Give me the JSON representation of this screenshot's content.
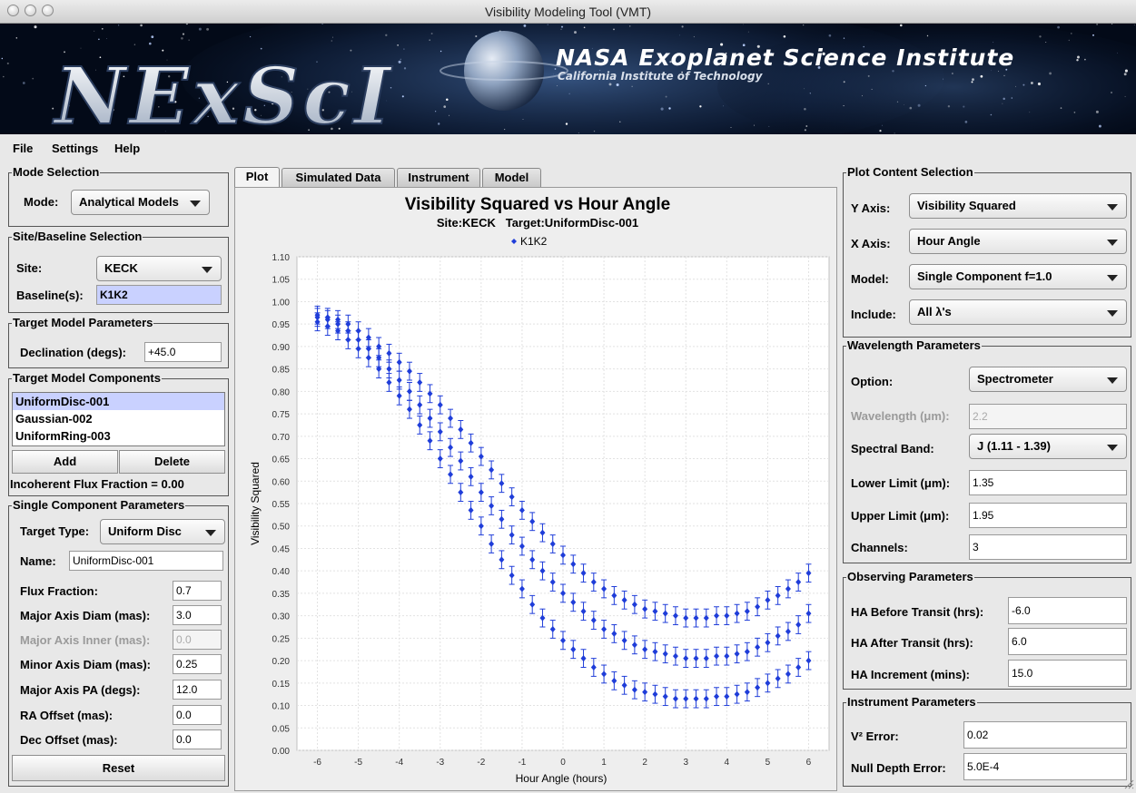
{
  "window": {
    "title": "Visibility Modeling Tool (VMT)"
  },
  "banner": {
    "logo": "NExScI",
    "headline": "NASA Exoplanet Science Institute",
    "subline": "California Institute of Technology"
  },
  "menu": [
    "File",
    "Settings",
    "Help"
  ],
  "mode_selection": {
    "legend": "Mode Selection",
    "mode_label": "Mode:",
    "mode_value": "Analytical Models"
  },
  "site_selection": {
    "legend": "Site/Baseline Selection",
    "site_label": "Site:",
    "site_value": "KECK",
    "baseline_label": "Baseline(s):",
    "baseline_value": "K1K2"
  },
  "target_params": {
    "legend": "Target Model Parameters",
    "decl_label": "Declination (degs):",
    "decl_value": "+45.0"
  },
  "target_components": {
    "legend": "Target Model Components",
    "items": [
      "UniformDisc-001",
      "Gaussian-002",
      "UniformRing-003"
    ],
    "selected": 0,
    "add_label": "Add",
    "delete_label": "Delete",
    "incoherent": "Incoherent Flux Fraction = 0.00"
  },
  "single_component": {
    "legend": "Single Component Parameters",
    "type_label": "Target Type:",
    "type_value": "Uniform Disc",
    "name_label": "Name:",
    "name_value": "UniformDisc-001",
    "fields": [
      {
        "label": "Flux Fraction:",
        "value": "0.7",
        "disabled": false
      },
      {
        "label": "Major Axis Diam (mas):",
        "value": "3.0",
        "disabled": false
      },
      {
        "label": "Major Axis Inner (mas):",
        "value": "0.0",
        "disabled": true
      },
      {
        "label": "Minor Axis Diam (mas):",
        "value": "0.25",
        "disabled": false
      },
      {
        "label": "Major Axis PA (degs):",
        "value": "12.0",
        "disabled": false
      },
      {
        "label": "RA Offset (mas):",
        "value": "0.0",
        "disabled": false
      },
      {
        "label": "Dec Offset (mas):",
        "value": "0.0",
        "disabled": false
      }
    ],
    "reset_label": "Reset"
  },
  "tabs": [
    "Plot",
    "Simulated Data",
    "Instrument",
    "Model"
  ],
  "active_tab": 0,
  "plot_content": {
    "legend": "Plot Content Selection",
    "rows": [
      {
        "label": "Y Axis:",
        "value": "Visibility Squared"
      },
      {
        "label": "X Axis:",
        "value": "Hour Angle"
      },
      {
        "label": "Model:",
        "value": "Single Component f=1.0"
      },
      {
        "label": "Include:",
        "value": "All λ's"
      }
    ]
  },
  "wavelength": {
    "legend": "Wavelength Parameters",
    "option_label": "Option:",
    "option_value": "Spectrometer",
    "wl_label": "Wavelength (μm):",
    "wl_value": "2.2",
    "band_label": "Spectral Band:",
    "band_value": "J (1.11 - 1.39)",
    "lower_label": "Lower Limit (μm):",
    "lower_value": "1.35",
    "upper_label": "Upper Limit (μm):",
    "upper_value": "1.95",
    "channels_label": "Channels:",
    "channels_value": "3"
  },
  "observing": {
    "legend": "Observing Parameters",
    "before_label": "HA Before Transit (hrs):",
    "before_value": "-6.0",
    "after_label": "HA After Transit (hrs):",
    "after_value": "6.0",
    "incr_label": "HA Increment (mins):",
    "incr_value": "15.0"
  },
  "instrument": {
    "legend": "Instrument Parameters",
    "v2err_label": "V² Error:",
    "v2err_value": "0.02",
    "null_label": "Null Depth Error:",
    "null_value": "5.0E-4"
  },
  "chart_data": {
    "type": "scatter",
    "title": "Visibility Squared vs Hour Angle",
    "subtitle": "Site:KECK   Target:UniformDisc-001",
    "legend": [
      "K1K2"
    ],
    "xlabel": "Hour Angle (hours)",
    "ylabel": "Visibility Squared",
    "xlim": [
      -6.5,
      6.5
    ],
    "ylim": [
      0,
      1.1
    ],
    "xticks": [
      "-6",
      "-5",
      "-4",
      "-3",
      "-2",
      "-1",
      "0",
      "1",
      "2",
      "3",
      "4",
      "5",
      "6"
    ],
    "yticks": [
      "0.00",
      "0.05",
      "0.10",
      "0.15",
      "0.20",
      "0.25",
      "0.30",
      "0.35",
      "0.40",
      "0.45",
      "0.50",
      "0.55",
      "0.60",
      "0.65",
      "0.70",
      "0.75",
      "0.80",
      "0.85",
      "0.90",
      "0.95",
      "1.00",
      "1.05",
      "1.10"
    ],
    "error": 0.02,
    "x": [
      -6,
      -5.75,
      -5.5,
      -5.25,
      -5,
      -4.75,
      -4.5,
      -4.25,
      -4,
      -3.75,
      -3.5,
      -3.25,
      -3,
      -2.75,
      -2.5,
      -2.25,
      -2,
      -1.75,
      -1.5,
      -1.25,
      -1,
      -0.75,
      -0.5,
      -0.25,
      0,
      0.25,
      0.5,
      0.75,
      1,
      1.25,
      1.5,
      1.75,
      2,
      2.25,
      2.5,
      2.75,
      3,
      3.25,
      3.5,
      3.75,
      4,
      4.25,
      4.5,
      4.75,
      5,
      5.25,
      5.5,
      5.75,
      6
    ],
    "series": [
      {
        "name": "K1K2",
        "values": [
          0.97,
          0.965,
          0.96,
          0.95,
          0.935,
          0.92,
          0.9,
          0.885,
          0.865,
          0.845,
          0.82,
          0.795,
          0.77,
          0.74,
          0.715,
          0.685,
          0.655,
          0.625,
          0.595,
          0.565,
          0.535,
          0.51,
          0.485,
          0.46,
          0.435,
          0.415,
          0.395,
          0.375,
          0.36,
          0.345,
          0.335,
          0.325,
          0.315,
          0.31,
          0.305,
          0.3,
          0.295,
          0.295,
          0.295,
          0.3,
          0.3,
          0.305,
          0.31,
          0.32,
          0.335,
          0.345,
          0.36,
          0.375,
          0.395
        ]
      },
      {
        "name": "K1K2",
        "values": [
          0.965,
          0.96,
          0.95,
          0.935,
          0.915,
          0.895,
          0.875,
          0.85,
          0.825,
          0.8,
          0.77,
          0.74,
          0.71,
          0.675,
          0.645,
          0.61,
          0.575,
          0.545,
          0.515,
          0.48,
          0.455,
          0.425,
          0.4,
          0.375,
          0.35,
          0.33,
          0.31,
          0.29,
          0.27,
          0.26,
          0.245,
          0.235,
          0.225,
          0.22,
          0.215,
          0.21,
          0.205,
          0.205,
          0.205,
          0.21,
          0.21,
          0.215,
          0.22,
          0.23,
          0.24,
          0.255,
          0.265,
          0.28,
          0.305
        ]
      },
      {
        "name": "K1K2",
        "values": [
          0.955,
          0.945,
          0.935,
          0.915,
          0.895,
          0.875,
          0.85,
          0.82,
          0.79,
          0.76,
          0.725,
          0.69,
          0.65,
          0.615,
          0.575,
          0.535,
          0.5,
          0.46,
          0.425,
          0.39,
          0.36,
          0.325,
          0.295,
          0.27,
          0.245,
          0.225,
          0.205,
          0.185,
          0.17,
          0.155,
          0.145,
          0.135,
          0.13,
          0.125,
          0.12,
          0.115,
          0.115,
          0.115,
          0.115,
          0.12,
          0.12,
          0.125,
          0.13,
          0.14,
          0.15,
          0.16,
          0.17,
          0.185,
          0.2
        ]
      }
    ]
  }
}
